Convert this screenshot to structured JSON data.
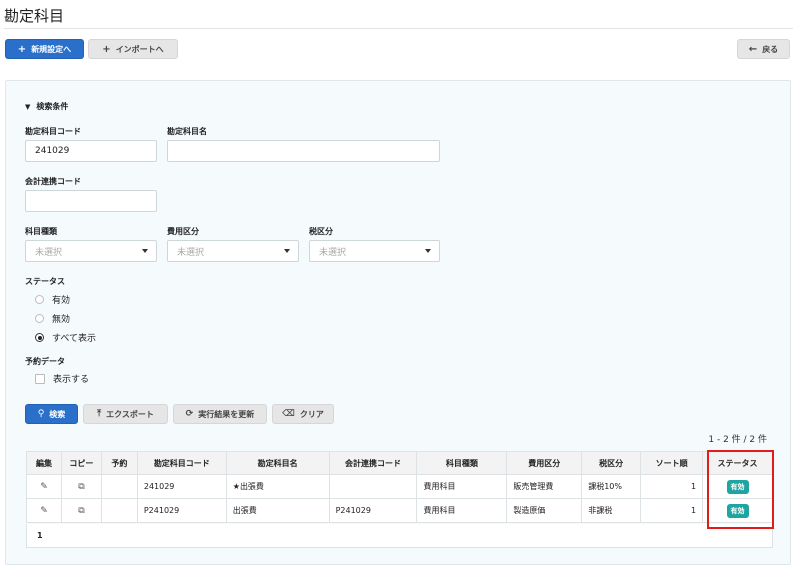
{
  "page": {
    "title": "勘定科目"
  },
  "toolbar": {
    "new_label": "新規設定へ",
    "import_label": "インポートへ",
    "back_label": "戻る"
  },
  "search": {
    "section_label": "検索条件",
    "code_label": "勘定科目コード",
    "code_value": "241029",
    "name_label": "勘定科目名",
    "name_value": "",
    "link_code_label": "会計連携コード",
    "link_code_value": "",
    "type_label": "科目種類",
    "cost_label": "費用区分",
    "tax_label": "税区分",
    "select_placeholder": "未選択",
    "status_label": "ステータス",
    "status_options": [
      "有効",
      "無効",
      "すべて表示"
    ],
    "status_selected": "すべて表示",
    "reserve_label": "予約データ",
    "reserve_checkbox_label": "表示する"
  },
  "actions": {
    "search_label": "検索",
    "export_label": "エクスポート",
    "refresh_label": "実行結果を更新",
    "clear_label": "クリア"
  },
  "results": {
    "count_text": "1 - 2 件 / 2 件",
    "columns": [
      "編集",
      "コピー",
      "予約",
      "勘定科目コード",
      "勘定科目名",
      "会計連携コード",
      "科目種類",
      "費用区分",
      "税区分",
      "ソート順",
      "ステータス"
    ],
    "rows": [
      {
        "code": "241029",
        "name": "★出張費",
        "link_code": "",
        "type": "費用科目",
        "cost": "販売管理費",
        "tax": "課税10%",
        "sort": "1",
        "status": "有効"
      },
      {
        "code": "P241029",
        "name": "出張費",
        "link_code": "P241029",
        "type": "費用科目",
        "cost": "製造原価",
        "tax": "非課税",
        "sort": "1",
        "status": "有効"
      }
    ],
    "page_number": "1"
  },
  "colors": {
    "primary": "#2a6fc9",
    "badge": "#1fa5a1",
    "highlight": "#e21b1b"
  }
}
